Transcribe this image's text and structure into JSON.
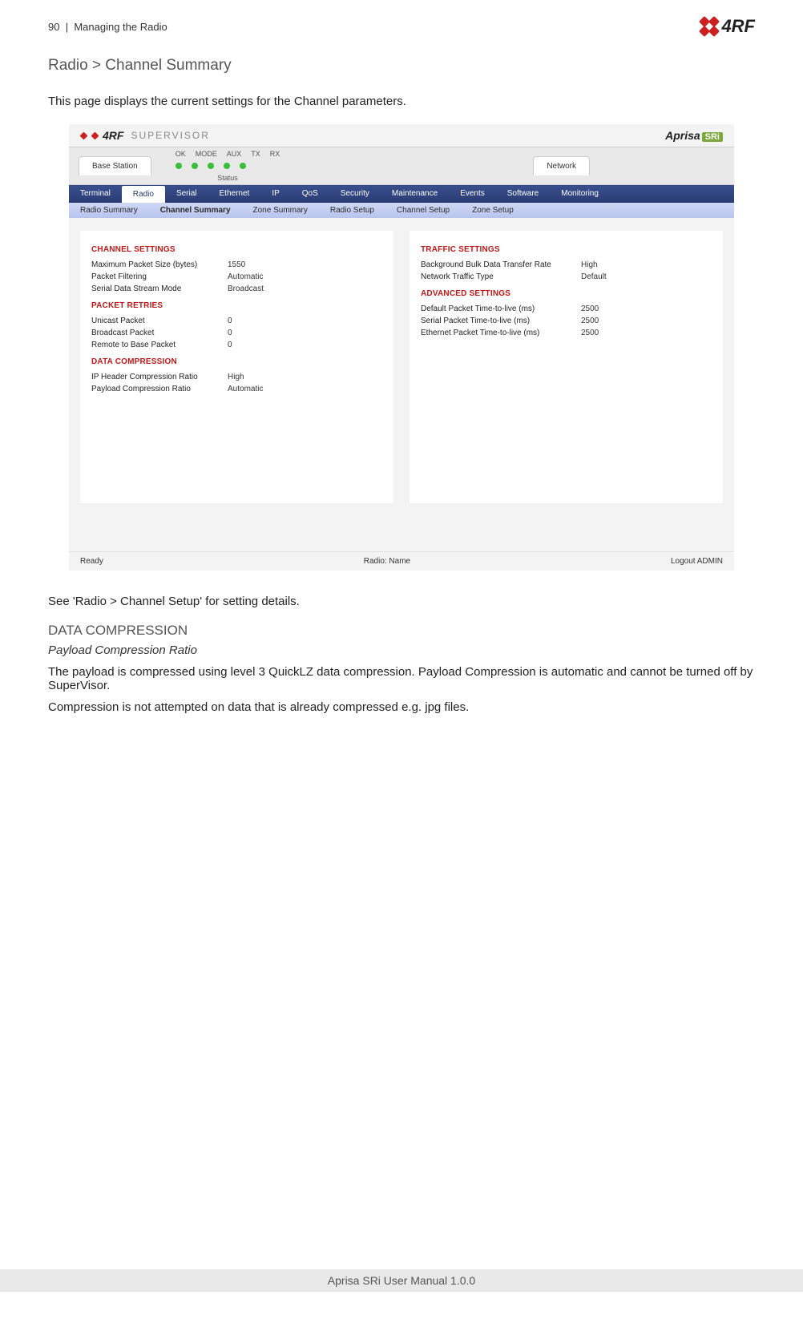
{
  "header": {
    "page_num": "90",
    "separator": "|",
    "section": "Managing the Radio"
  },
  "logo": {
    "brand_text": "4RF"
  },
  "breadcrumb": "Radio > Channel Summary",
  "intro": "This page displays the current settings for the Channel parameters.",
  "screenshot": {
    "titlebar": {
      "brand": "4RF",
      "product": "SUPERVISOR",
      "aprisa": "Aprisa",
      "sri": "SRi"
    },
    "tabs": {
      "base": "Base Station",
      "network": "Network"
    },
    "leds": {
      "labels": [
        "OK",
        "MODE",
        "AUX",
        "TX",
        "RX"
      ],
      "status_label": "Status"
    },
    "nav": [
      "Terminal",
      "Radio",
      "Serial",
      "Ethernet",
      "IP",
      "QoS",
      "Security",
      "Maintenance",
      "Events",
      "Software",
      "Monitoring"
    ],
    "nav_active_index": 1,
    "subnav": [
      "Radio Summary",
      "Channel Summary",
      "Zone Summary",
      "Radio Setup",
      "Channel Setup",
      "Zone Setup"
    ],
    "subnav_active_index": 1,
    "left_panel": {
      "sections": [
        {
          "title": "CHANNEL SETTINGS",
          "rows": [
            {
              "k": "Maximum Packet Size (bytes)",
              "v": "1550"
            },
            {
              "k": "Packet Filtering",
              "v": "Automatic"
            },
            {
              "k": "Serial Data Stream Mode",
              "v": "Broadcast"
            }
          ]
        },
        {
          "title": "PACKET RETRIES",
          "rows": [
            {
              "k": "Unicast Packet",
              "v": "0"
            },
            {
              "k": "Broadcast Packet",
              "v": "0"
            },
            {
              "k": "Remote to Base Packet",
              "v": "0"
            }
          ]
        },
        {
          "title": "DATA COMPRESSION",
          "rows": [
            {
              "k": "IP Header Compression Ratio",
              "v": "High"
            },
            {
              "k": "Payload Compression Ratio",
              "v": "Automatic"
            }
          ]
        }
      ]
    },
    "right_panel": {
      "sections": [
        {
          "title": "TRAFFIC SETTINGS",
          "rows": [
            {
              "k": "Background Bulk Data Transfer Rate",
              "v": "High"
            },
            {
              "k": "Network Traffic Type",
              "v": "Default"
            }
          ]
        },
        {
          "title": "ADVANCED SETTINGS",
          "rows": [
            {
              "k": "Default Packet Time-to-live (ms)",
              "v": "2500"
            },
            {
              "k": "Serial Packet Time-to-live (ms)",
              "v": "2500"
            },
            {
              "k": "Ethernet Packet Time-to-live (ms)",
              "v": "2500"
            }
          ]
        }
      ]
    },
    "footer": {
      "left": "Ready",
      "center": "Radio: Name",
      "right": "Logout ADMIN"
    }
  },
  "see_note": "See 'Radio > Channel Setup' for setting details.",
  "section_heading": "DATA COMPRESSION",
  "sub_heading": "Payload Compression Ratio",
  "para1": "The payload is compressed using level 3 QuickLZ data compression. Payload Compression is automatic and cannot be turned off by SuperVisor.",
  "para2": "Compression is not attempted on data that is already compressed e.g. jpg files.",
  "page_footer": "Aprisa SRi User Manual 1.0.0"
}
